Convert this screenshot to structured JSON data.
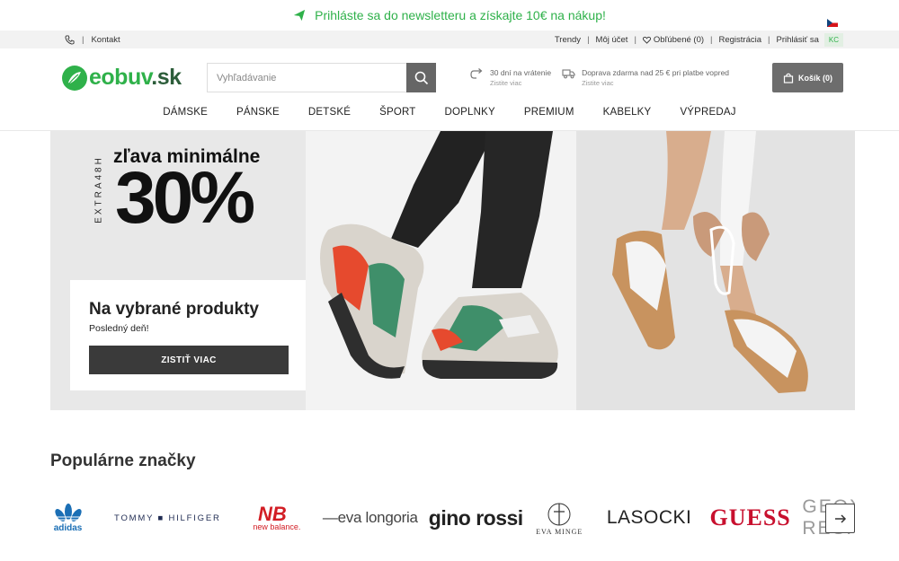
{
  "promo": {
    "text": "Prihláste sa do newsletteru a získajte 10€ na nákup!",
    "color": "#2fb14a"
  },
  "utility": {
    "contact_label": "Kontakt",
    "links": [
      {
        "label": "Trendy"
      },
      {
        "label": "Môj účet"
      },
      {
        "label": "Obľúbené (0)",
        "icon": "heart-icon"
      },
      {
        "label": "Registrácia"
      },
      {
        "label": "Prihlásiť sa"
      }
    ],
    "badge": "KC"
  },
  "header": {
    "logo": {
      "main": "eobuv",
      "suffix": ".sk"
    },
    "search": {
      "placeholder": "Vyhľadávanie"
    },
    "benefits": [
      {
        "title": "30 dní na vrátenie",
        "sub": "Zistite viac",
        "icon": "return-icon"
      },
      {
        "title": "Doprava zdarma nad 25 € pri platbe vopred",
        "sub": "Zistite viac",
        "icon": "truck-icon"
      }
    ],
    "cart_label": "Košík (0)"
  },
  "nav": [
    "DÁMSKE",
    "PÁNSKE",
    "DETSKÉ",
    "ŠPORT",
    "DOPLNKY",
    "PREMIUM",
    "KABELKY",
    "VÝPREDAJ"
  ],
  "hero": {
    "vertical": "EXTRA48H",
    "headline": "zľava minimálne",
    "percent": "30%",
    "card_title": "Na vybrané produkty",
    "card_sub": "Posledný deň!",
    "cta": "ZISTIŤ VIAC"
  },
  "brands": {
    "title": "Populárne značky",
    "items": [
      "adidas",
      "TOMMY ■ HILFIGER",
      "new balance.",
      "—eva longoria",
      "gino rossi",
      "EVA MINGE",
      "LASOCKI",
      "GUESS",
      "GEOX RESPIRA"
    ]
  },
  "colors": {
    "accent": "#2fb14a",
    "dark": "#3a3a3a"
  }
}
